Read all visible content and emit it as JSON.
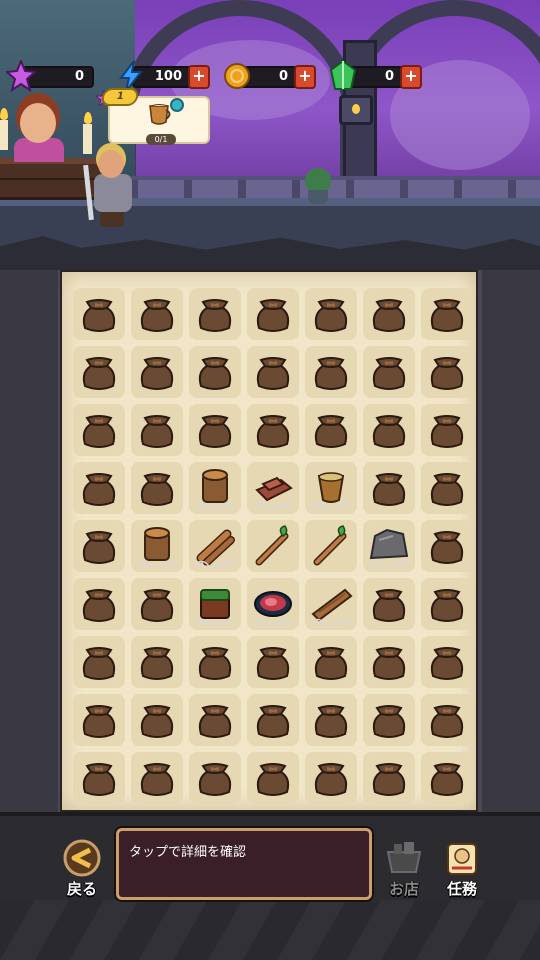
{
  "resources": [
    {
      "id": "gem-purple",
      "value": "0",
      "icon": "purple-star-gem-icon",
      "color": "#c85be0",
      "has_plus": false
    },
    {
      "id": "energy",
      "value": "100",
      "icon": "lightning-icon",
      "color": "#3aa0ff",
      "has_plus": true
    },
    {
      "id": "coin",
      "value": "0",
      "icon": "coin-icon",
      "color": "#f0a020",
      "has_plus": true
    },
    {
      "id": "gem-green",
      "value": "0",
      "icon": "green-crystal-icon",
      "color": "#3ec25a",
      "has_plus": true
    }
  ],
  "plus_label": "+",
  "quest": {
    "badge": "1",
    "progress": "0/1",
    "item_icon": "horn-cup-icon"
  },
  "board": {
    "columns": 7,
    "rows": 9,
    "cells": [
      [
        "bag",
        "bag",
        "bag",
        "bag",
        "bag",
        "bag",
        "bag"
      ],
      [
        "bag",
        "bag",
        "bag",
        "bag",
        "bag",
        "bag",
        "bag"
      ],
      [
        "bag",
        "bag",
        "bag",
        "bag",
        "bag",
        "bag",
        "bag"
      ],
      [
        "bag",
        "bag",
        "stump-web",
        "bricks-web",
        "cup-web",
        "bag",
        "bag"
      ],
      [
        "bag",
        "stump-web",
        "logs-web",
        "sprout-stick",
        "sprout-stick",
        "rock-web",
        "bag"
      ],
      [
        "bag",
        "bag",
        "grass-block-web",
        "meat-web",
        "plank-web",
        "bag",
        "bag"
      ],
      [
        "bag",
        "bag",
        "bag",
        "bag",
        "bag",
        "bag",
        "bag"
      ],
      [
        "bag",
        "bag",
        "bag",
        "bag",
        "bag",
        "bag",
        "bag"
      ],
      [
        "bag",
        "bag",
        "bag",
        "bag",
        "bag",
        "bag",
        "bag"
      ]
    ]
  },
  "bottom": {
    "back_label": "戻る",
    "info_text": "タップで詳細を確認",
    "shop_label": "お店",
    "tasks_label": "任務"
  },
  "colors": {
    "board_bg": "#f1e6c8",
    "cell_bg": "#e7d8b4",
    "bag": "#6b4a33",
    "info_box": "#3b1f28",
    "plus_button": "#d84a2e"
  }
}
